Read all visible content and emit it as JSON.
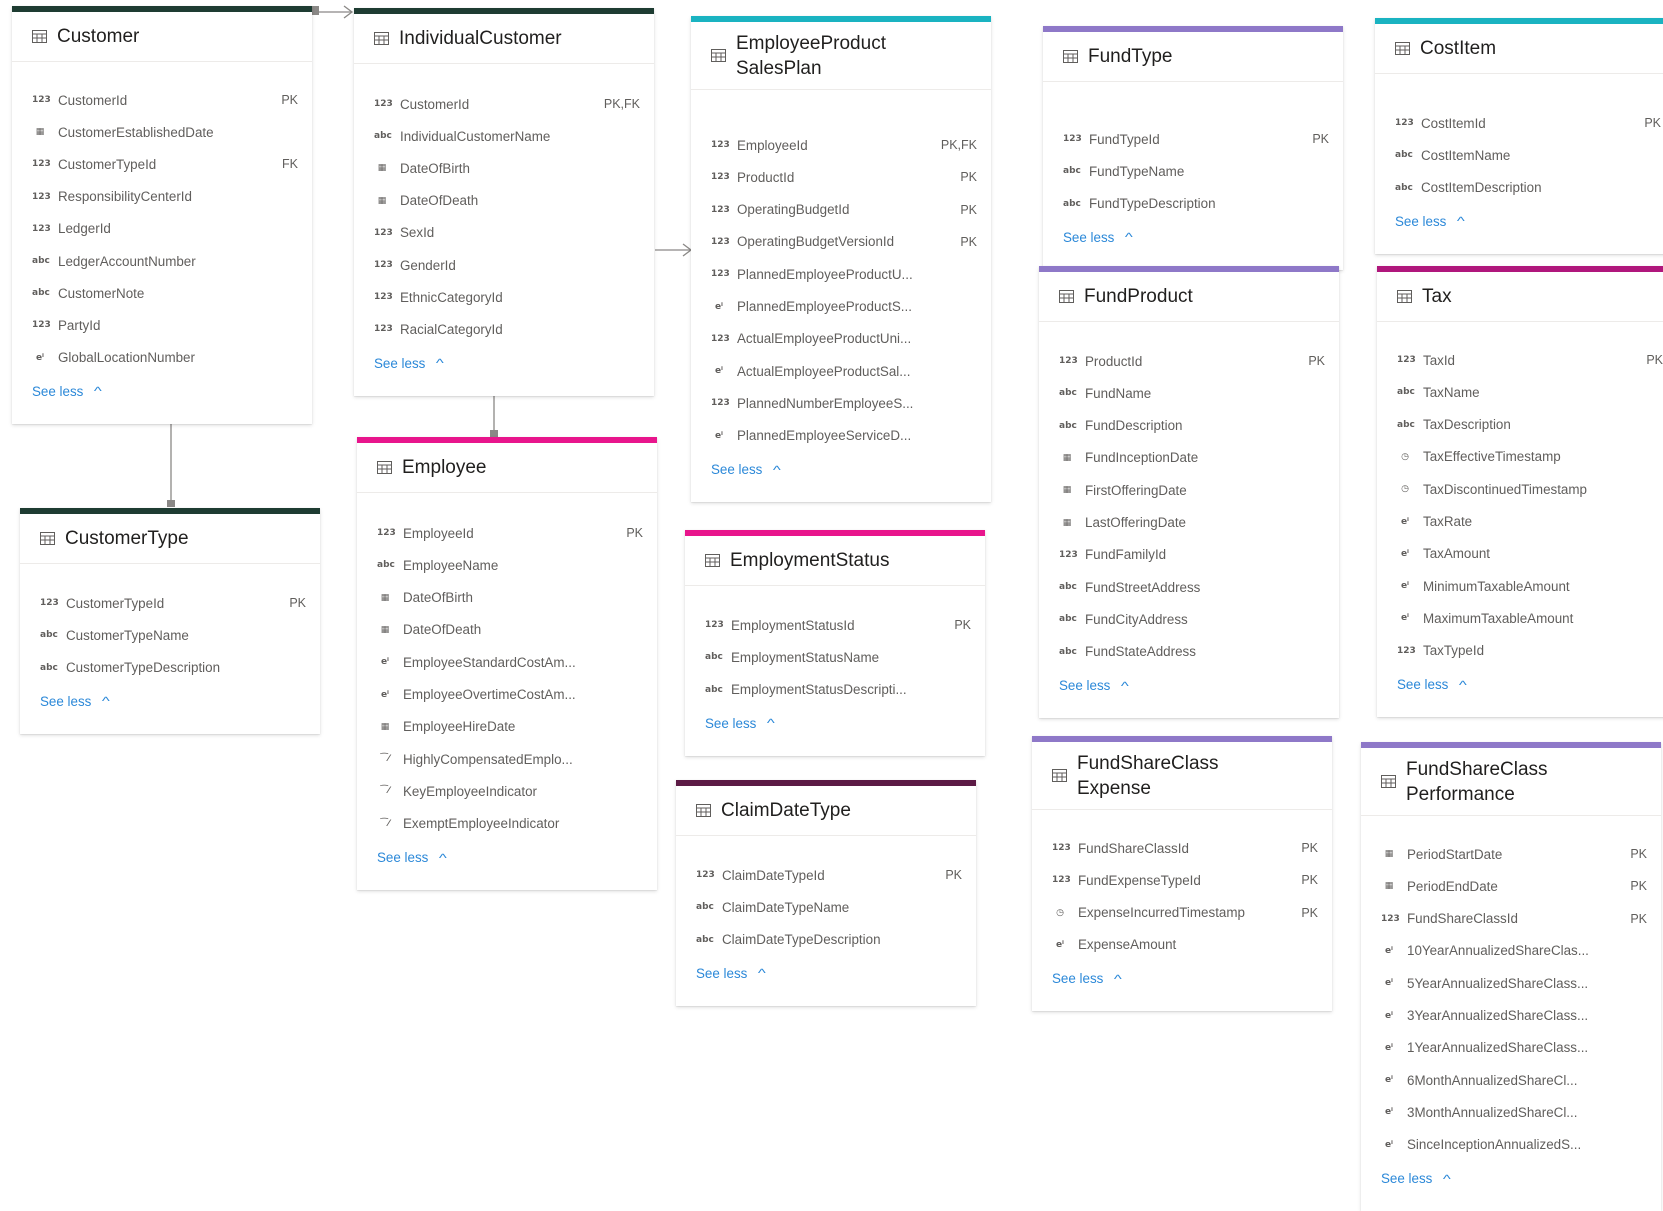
{
  "colors": {
    "dark_green": "#1e3c32",
    "teal": "#1ab3c1",
    "purple": "#8e78c8",
    "magenta": "#e8158c",
    "plum": "#5c1a45",
    "berry": "#b0177c",
    "link": "#2b88d8",
    "connector": "#8a8886"
  },
  "entities": [
    {
      "id": "customer",
      "title": [
        "Customer"
      ],
      "see_less": "See less",
      "rows": [
        {
          "type": "123",
          "name": "CustomerId",
          "key": "PK"
        },
        {
          "type": "date",
          "name": "CustomerEstablishedDate",
          "key": ""
        },
        {
          "type": "123",
          "name": "CustomerTypeId",
          "key": "FK"
        },
        {
          "type": "123",
          "name": "ResponsibilityCenterId",
          "key": ""
        },
        {
          "type": "123",
          "name": "LedgerId",
          "key": ""
        },
        {
          "type": "abc",
          "name": "LedgerAccountNumber",
          "key": ""
        },
        {
          "type": "abc",
          "name": "CustomerNote",
          "key": ""
        },
        {
          "type": "123",
          "name": "PartyId",
          "key": ""
        },
        {
          "type": "dec",
          "name": "GlobalLocationNumber",
          "key": ""
        }
      ]
    },
    {
      "id": "individualcustomer",
      "title": [
        "IndividualCustomer"
      ],
      "see_less": "See less",
      "rows": [
        {
          "type": "123",
          "name": "CustomerId",
          "key": "PK,FK"
        },
        {
          "type": "abc",
          "name": "IndividualCustomerName",
          "key": ""
        },
        {
          "type": "date",
          "name": "DateOfBirth",
          "key": ""
        },
        {
          "type": "date",
          "name": "DateOfDeath",
          "key": ""
        },
        {
          "type": "123",
          "name": "SexId",
          "key": ""
        },
        {
          "type": "123",
          "name": "GenderId",
          "key": ""
        },
        {
          "type": "123",
          "name": "EthnicCategoryId",
          "key": ""
        },
        {
          "type": "123",
          "name": "RacialCategoryId",
          "key": ""
        }
      ]
    },
    {
      "id": "employeeproductsalesplan",
      "title": [
        "EmployeeProduct",
        "SalesPlan"
      ],
      "see_less": "See less",
      "rows": [
        {
          "type": "123",
          "name": "EmployeeId",
          "key": "PK,FK"
        },
        {
          "type": "123",
          "name": "ProductId",
          "key": "PK"
        },
        {
          "type": "123",
          "name": "OperatingBudgetId",
          "key": "PK"
        },
        {
          "type": "123",
          "name": "OperatingBudgetVersionId",
          "key": "PK"
        },
        {
          "type": "123",
          "name": "PlannedEmployeeProductU...",
          "key": ""
        },
        {
          "type": "dec",
          "name": "PlannedEmployeeProductS...",
          "key": ""
        },
        {
          "type": "123",
          "name": "ActualEmployeeProductUni...",
          "key": ""
        },
        {
          "type": "dec",
          "name": "ActualEmployeeProductSal...",
          "key": ""
        },
        {
          "type": "123",
          "name": "PlannedNumberEmployeeS...",
          "key": ""
        },
        {
          "type": "dec",
          "name": "PlannedEmployeeServiceD...",
          "key": ""
        }
      ]
    },
    {
      "id": "fundtype",
      "title": [
        "FundType"
      ],
      "see_less": "See less",
      "rows": [
        {
          "type": "123",
          "name": "FundTypeId",
          "key": "PK"
        },
        {
          "type": "abc",
          "name": "FundTypeName",
          "key": ""
        },
        {
          "type": "abc",
          "name": "FundTypeDescription",
          "key": ""
        }
      ]
    },
    {
      "id": "costitem",
      "title": [
        "CostItem"
      ],
      "see_less": "See less",
      "rows": [
        {
          "type": "123",
          "name": "CostItemId",
          "key": "PK"
        },
        {
          "type": "abc",
          "name": "CostItemName",
          "key": ""
        },
        {
          "type": "abc",
          "name": "CostItemDescription",
          "key": ""
        }
      ]
    },
    {
      "id": "customertype",
      "title": [
        "CustomerType"
      ],
      "see_less": "See less",
      "rows": [
        {
          "type": "123",
          "name": "CustomerTypeId",
          "key": "PK"
        },
        {
          "type": "abc",
          "name": "CustomerTypeName",
          "key": ""
        },
        {
          "type": "abc",
          "name": "CustomerTypeDescription",
          "key": ""
        }
      ]
    },
    {
      "id": "employee",
      "title": [
        "Employee"
      ],
      "see_less": "See less",
      "rows": [
        {
          "type": "123",
          "name": "EmployeeId",
          "key": "PK"
        },
        {
          "type": "abc",
          "name": "EmployeeName",
          "key": ""
        },
        {
          "type": "date",
          "name": "DateOfBirth",
          "key": ""
        },
        {
          "type": "date",
          "name": "DateOfDeath",
          "key": ""
        },
        {
          "type": "dec",
          "name": "EmployeeStandardCostAm...",
          "key": ""
        },
        {
          "type": "dec",
          "name": "EmployeeOvertimeCostAm...",
          "key": ""
        },
        {
          "type": "date",
          "name": "EmployeeHireDate",
          "key": ""
        },
        {
          "type": "bool",
          "name": "HighlyCompensatedEmplo...",
          "key": ""
        },
        {
          "type": "bool",
          "name": "KeyEmployeeIndicator",
          "key": ""
        },
        {
          "type": "bool",
          "name": "ExemptEmployeeIndicator",
          "key": ""
        }
      ]
    },
    {
      "id": "employmentstatus",
      "title": [
        "EmploymentStatus"
      ],
      "see_less": "See less",
      "rows": [
        {
          "type": "123",
          "name": "EmploymentStatusId",
          "key": "PK"
        },
        {
          "type": "abc",
          "name": "EmploymentStatusName",
          "key": ""
        },
        {
          "type": "abc",
          "name": "EmploymentStatusDescripti...",
          "key": ""
        }
      ]
    },
    {
      "id": "claimdatetype",
      "title": [
        "ClaimDateType"
      ],
      "see_less": "See less",
      "rows": [
        {
          "type": "123",
          "name": "ClaimDateTypeId",
          "key": "PK"
        },
        {
          "type": "abc",
          "name": "ClaimDateTypeName",
          "key": ""
        },
        {
          "type": "abc",
          "name": "ClaimDateTypeDescription",
          "key": ""
        }
      ]
    },
    {
      "id": "fundproduct",
      "title": [
        "FundProduct"
      ],
      "see_less": "See less",
      "rows": [
        {
          "type": "123",
          "name": "ProductId",
          "key": "PK"
        },
        {
          "type": "abc",
          "name": "FundName",
          "key": ""
        },
        {
          "type": "abc",
          "name": "FundDescription",
          "key": ""
        },
        {
          "type": "date",
          "name": "FundInceptionDate",
          "key": ""
        },
        {
          "type": "date",
          "name": "FirstOfferingDate",
          "key": ""
        },
        {
          "type": "date",
          "name": "LastOfferingDate",
          "key": ""
        },
        {
          "type": "123",
          "name": "FundFamilyId",
          "key": ""
        },
        {
          "type": "abc",
          "name": "FundStreetAddress",
          "key": ""
        },
        {
          "type": "abc",
          "name": "FundCityAddress",
          "key": ""
        },
        {
          "type": "abc",
          "name": "FundStateAddress",
          "key": ""
        }
      ]
    },
    {
      "id": "tax",
      "title": [
        "Tax"
      ],
      "see_less": "See less",
      "rows": [
        {
          "type": "123",
          "name": "TaxId",
          "key": "PK"
        },
        {
          "type": "abc",
          "name": "TaxName",
          "key": ""
        },
        {
          "type": "abc",
          "name": "TaxDescription",
          "key": ""
        },
        {
          "type": "ts",
          "name": "TaxEffectiveTimestamp",
          "key": ""
        },
        {
          "type": "ts",
          "name": "TaxDiscontinuedTimestamp",
          "key": ""
        },
        {
          "type": "dec",
          "name": "TaxRate",
          "key": ""
        },
        {
          "type": "dec",
          "name": "TaxAmount",
          "key": ""
        },
        {
          "type": "dec",
          "name": "MinimumTaxableAmount",
          "key": ""
        },
        {
          "type": "dec",
          "name": "MaximumTaxableAmount",
          "key": ""
        },
        {
          "type": "123",
          "name": "TaxTypeId",
          "key": ""
        }
      ]
    },
    {
      "id": "fundshareclassexpense",
      "title": [
        "FundShareClass",
        "Expense"
      ],
      "see_less": "See less",
      "rows": [
        {
          "type": "123",
          "name": "FundShareClassId",
          "key": "PK"
        },
        {
          "type": "123",
          "name": "FundExpenseTypeId",
          "key": "PK"
        },
        {
          "type": "ts",
          "name": "ExpenseIncurredTimestamp",
          "key": "PK"
        },
        {
          "type": "dec",
          "name": "ExpenseAmount",
          "key": ""
        }
      ]
    },
    {
      "id": "fundshareclassperformance",
      "title": [
        "FundShareClass",
        "Performance"
      ],
      "see_less": "See less",
      "rows": [
        {
          "type": "date",
          "name": "PeriodStartDate",
          "key": "PK"
        },
        {
          "type": "date",
          "name": "PeriodEndDate",
          "key": "PK"
        },
        {
          "type": "123",
          "name": "FundShareClassId",
          "key": "PK"
        },
        {
          "type": "dec",
          "name": "10YearAnnualizedShareClas...",
          "key": ""
        },
        {
          "type": "dec",
          "name": "5YearAnnualizedShareClass...",
          "key": ""
        },
        {
          "type": "dec",
          "name": "3YearAnnualizedShareClass...",
          "key": ""
        },
        {
          "type": "dec",
          "name": "1YearAnnualizedShareClass...",
          "key": ""
        },
        {
          "type": "dec",
          "name": "6MonthAnnualizedShareCl...",
          "key": ""
        },
        {
          "type": "dec",
          "name": "3MonthAnnualizedShareCl...",
          "key": ""
        },
        {
          "type": "dec",
          "name": "SinceInceptionAnnualizedS...",
          "key": ""
        }
      ]
    }
  ],
  "type_icons": {
    "123": "123-icon",
    "abc": "abc-icon",
    "date": "calendar-icon",
    "dec": "decimal-icon",
    "bool": "boolean-icon",
    "ts": "timestamp-icon"
  }
}
